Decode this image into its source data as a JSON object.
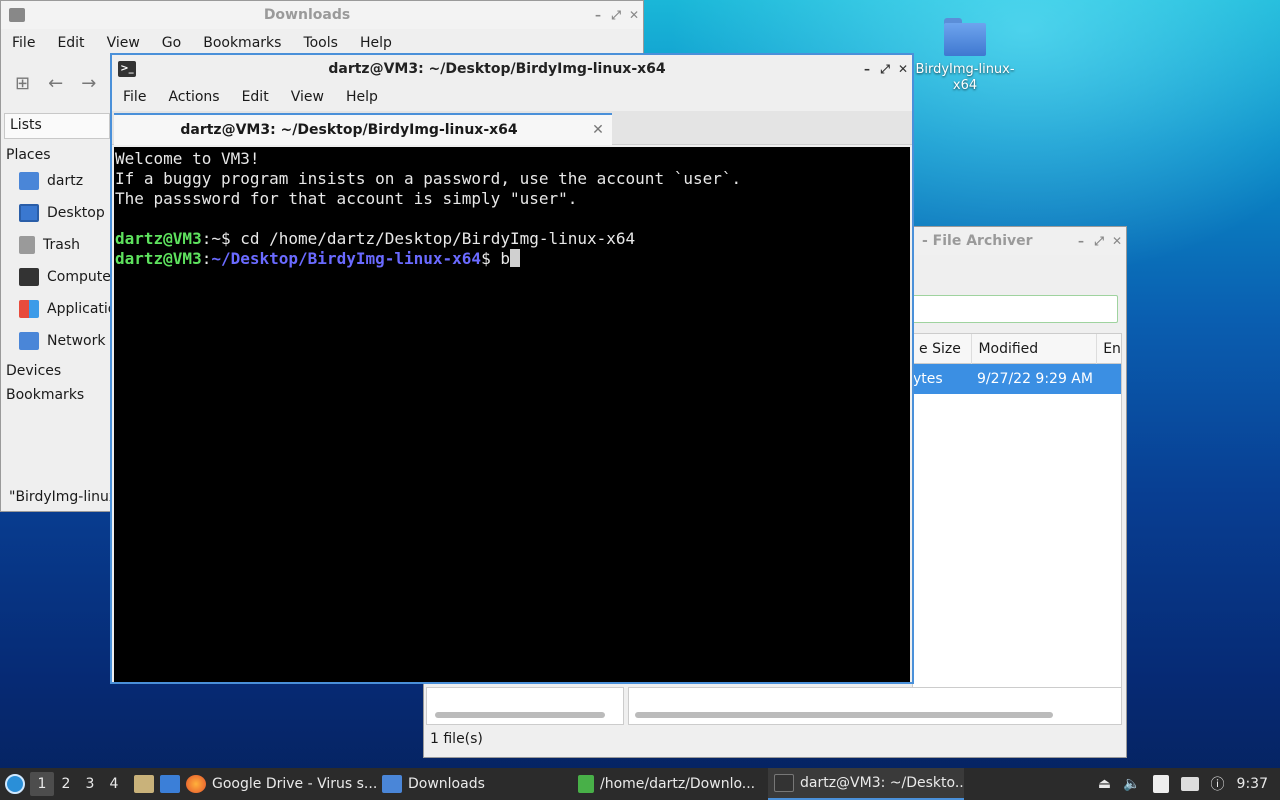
{
  "desktop": {
    "icon_label": "BirdyImg-linux-x64"
  },
  "downloads_window": {
    "title": "Downloads",
    "menu": [
      "File",
      "Edit",
      "View",
      "Go",
      "Bookmarks",
      "Tools",
      "Help"
    ],
    "lists_label": "Lists",
    "places_header": "Places",
    "places": [
      "dartz",
      "Desktop",
      "Trash",
      "Computer",
      "Applications",
      "Network"
    ],
    "devices_header": "Devices",
    "bookmarks_header": "Bookmarks",
    "status": "\"BirdyImg-linux"
  },
  "archiver_window": {
    "title": "- File Archiver",
    "col_size": "e Size",
    "col_modified": "Modified",
    "col_extra": "En",
    "row_size": "ytes",
    "row_modified": "9/27/22 9:29 AM",
    "status": "1 file(s)"
  },
  "terminal_window": {
    "title": "dartz@VM3: ~/Desktop/BirdyImg-linux-x64",
    "menu": [
      "File",
      "Actions",
      "Edit",
      "View",
      "Help"
    ],
    "tab_label": "dartz@VM3: ~/Desktop/BirdyImg-linux-x64",
    "lines": [
      "Welcome to VM3!",
      "If a buggy program insists on a password, use the account `user`.",
      "The passsword for that account is simply \"user\"."
    ],
    "prompt1_user": "dartz@VM3",
    "prompt1_path": ":~",
    "prompt1_cmd": "$ cd /home/dartz/Desktop/BirdyImg-linux-x64",
    "prompt2_user": "dartz@VM3",
    "prompt2_colon": ":",
    "prompt2_path": "~/Desktop/BirdyImg-linux-x64",
    "prompt2_cmd": "$ b"
  },
  "taskbar": {
    "workspaces": [
      "1",
      "2",
      "3",
      "4"
    ],
    "tasks": [
      {
        "label": "Google Drive - Virus s...",
        "icon": "firefox-icon"
      },
      {
        "label": "Downloads",
        "icon": "folder-icon"
      },
      {
        "label": "/home/dartz/Downlo...",
        "icon": "archive-icon"
      },
      {
        "label": "dartz@VM3: ~/Deskto...",
        "icon": "terminal-icon"
      }
    ],
    "clock": "9:37"
  }
}
